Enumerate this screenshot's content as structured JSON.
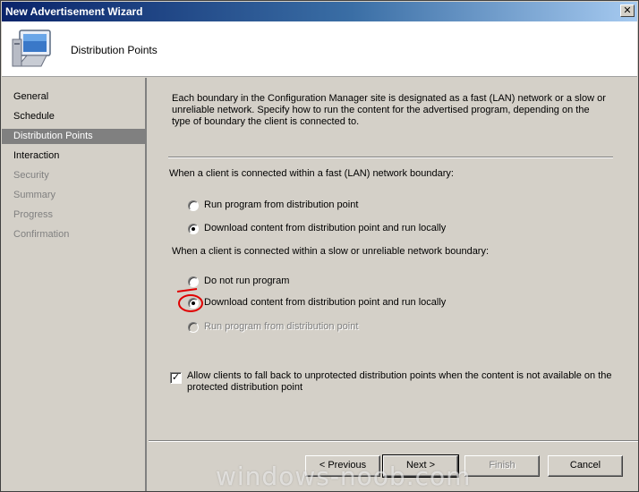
{
  "window": {
    "title": "New Advertisement Wizard",
    "close_glyph": "✕"
  },
  "header": {
    "title": "Distribution Points",
    "icon": "computer-icon"
  },
  "nav": {
    "items": [
      {
        "label": "General",
        "state": "normal"
      },
      {
        "label": "Schedule",
        "state": "normal"
      },
      {
        "label": "Distribution Points",
        "state": "selected"
      },
      {
        "label": "Interaction",
        "state": "normal"
      },
      {
        "label": "Security",
        "state": "disabled"
      },
      {
        "label": "Summary",
        "state": "disabled"
      },
      {
        "label": "Progress",
        "state": "disabled"
      },
      {
        "label": "Confirmation",
        "state": "disabled"
      }
    ]
  },
  "content": {
    "description": "Each boundary in the Configuration Manager site is designated as a fast (LAN) network or a slow or unreliable network. Specify how to run the content for the advertised program, depending on the type of boundary the client is connected to.",
    "fast_group_label": "When a client is connected within a fast (LAN) network boundary:",
    "fast_options": [
      {
        "label": "Run program from distribution point",
        "checked": false
      },
      {
        "label": "Download content from distribution point and run locally",
        "checked": true
      }
    ],
    "slow_group_label": "When a client is connected within a slow or unreliable network boundary:",
    "slow_options": [
      {
        "label": "Do not run program",
        "checked": false
      },
      {
        "label": "Download content from distribution point and run locally",
        "checked": true
      },
      {
        "label": "Run program from distribution point",
        "checked": false,
        "disabled": true
      }
    ],
    "fallback_checkbox": {
      "label": "Allow clients to fall back to unprotected distribution points when the content is not available on the protected distribution point",
      "checked": true
    }
  },
  "buttons": {
    "previous": "< Previous",
    "next": "Next >",
    "finish": "Finish",
    "cancel": "Cancel"
  },
  "watermark": "windows-noob.com",
  "colors": {
    "title_bar": "#0a246a",
    "selected_nav": "#808080",
    "annotation": "#e00000"
  }
}
